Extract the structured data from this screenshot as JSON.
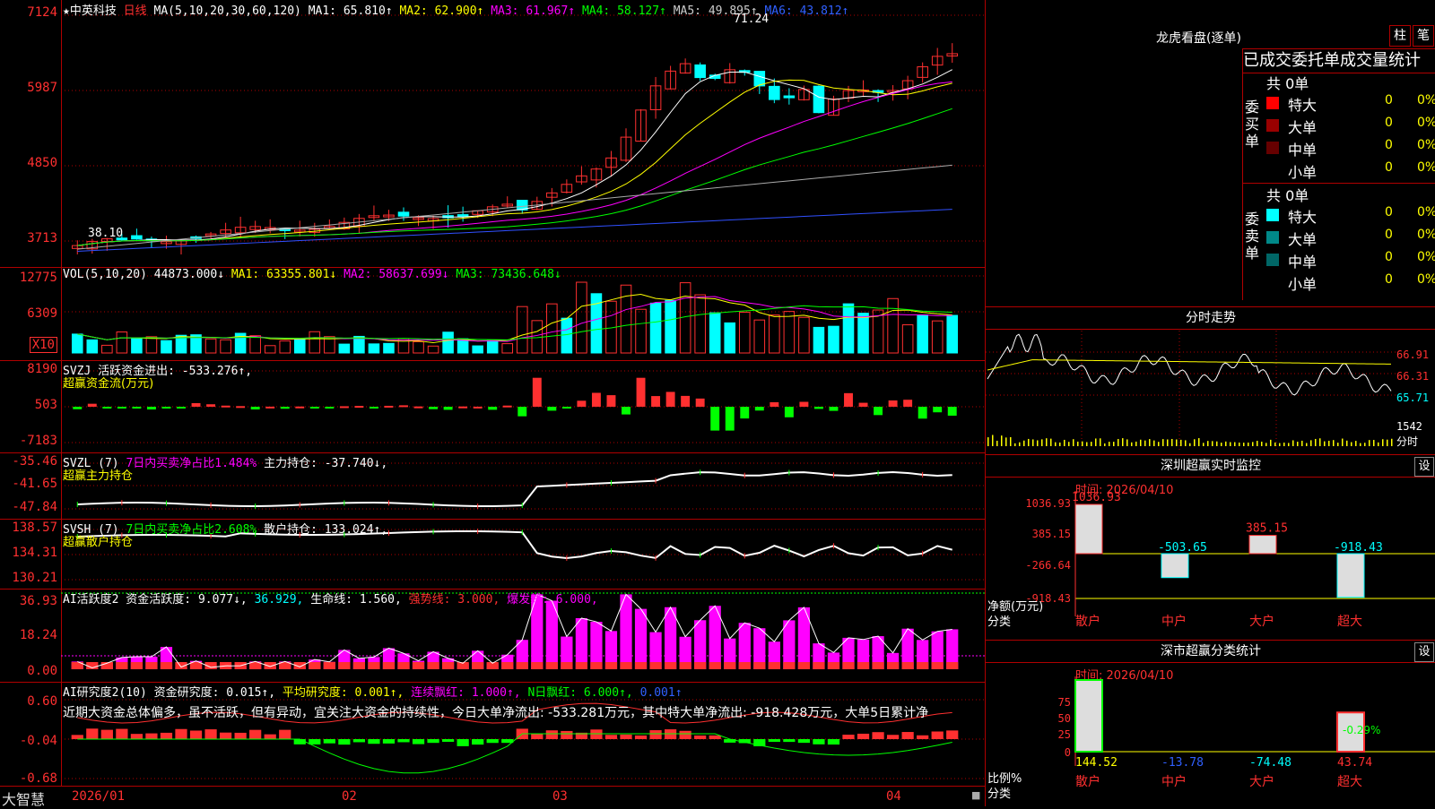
{
  "main": {
    "y_ticks": [
      "7124",
      "5987",
      "4850",
      "3713"
    ],
    "title_name": "★中英科技",
    "title_period": "日线",
    "title_ma": "MA(5,10,20,30,60,120)",
    "ma_labels": [
      "MA1: 65.810↑",
      "MA2: 62.900↑",
      "MA3: 61.967↑",
      "MA4: 58.127↑",
      "MA5: 49.895↑",
      "MA6: 43.812↑"
    ],
    "high_marker": "71.24",
    "low_marker": "38.10"
  },
  "vol": {
    "y_ticks": [
      "12775",
      "6309"
    ],
    "unit": "X10",
    "title": "VOL(5,10,20)",
    "value": "44873.000↓",
    "ma_labels": [
      "MA1: 63355.801↓",
      "MA2: 58637.699↓",
      "MA3: 73436.648↓"
    ]
  },
  "svzj": {
    "y_ticks": [
      "8190",
      "503",
      "-7183"
    ],
    "title": "SVZJ  活跃资金进出: -533.276↑,",
    "subtitle": "超赢资金流(万元)"
  },
  "svzl": {
    "y_ticks": [
      "-35.46",
      "-41.65",
      "-47.84"
    ],
    "title_a": "SVZL (7)",
    "title_b": "7日内买卖净占比1.484%",
    "title_c": "主力持仓: -37.740↓,",
    "subtitle": "超赢主力持仓"
  },
  "svsh": {
    "y_ticks": [
      "138.57",
      "134.31",
      "130.21"
    ],
    "title_a": "SVSH (7)",
    "title_b": "7日内买卖净占比2.608%",
    "title_c": "散户持仓: 133.024↑,",
    "subtitle": "超赢散户持仓"
  },
  "ai_active": {
    "y_ticks": [
      "36.93",
      "18.24",
      "0.00"
    ],
    "title_a": "AI活跃度2 资金活跃度: 9.077↓,",
    "title_b": "36.929,",
    "title_c": "生命线: 1.560,",
    "title_d": "强势线: 3.000,",
    "title_e": "爆发线: 6.000,"
  },
  "ai_research": {
    "y_ticks": [
      "0.60",
      "-0.04",
      "-0.68"
    ],
    "title_a": "AI研究度2(10) 资金研究度: 0.015↑,",
    "title_b": "平均研究度: 0.001↑,",
    "title_c": "连续飘红: 1.000↑,",
    "title_d": "N日飘红: 6.000↑,",
    "title_e": "0.001↑",
    "comment": "近期大资金总体偏多，虽不活跃，但有异动，宜关注大资金的持续性，今日大单净流出: -533.281万元，其中特大单净流出: -918.428万元，大单5日累计净"
  },
  "x_axis": {
    "brand": "大智慧",
    "labels": [
      "2026/01",
      "02",
      "03",
      "04"
    ]
  },
  "dragon": {
    "title": "龙虎看盘(逐单)",
    "btn_bar": "柱",
    "btn_pen": "笔",
    "header": "已成交委托单成交量统计",
    "buy_label": "委买单",
    "sell_label": "委卖单",
    "buy_total": "共 0单",
    "sell_total": "共 0单",
    "buy_rows": [
      {
        "name": "特大",
        "vol": "0",
        "pct": "0%"
      },
      {
        "name": "大单",
        "vol": "0",
        "pct": "0%"
      },
      {
        "name": "中单",
        "vol": "0",
        "pct": "0%"
      },
      {
        "name": "小单",
        "vol": "0",
        "pct": "0%"
      }
    ],
    "sell_rows": [
      {
        "name": "特大",
        "vol": "0",
        "pct": "0%"
      },
      {
        "name": "大单",
        "vol": "0",
        "pct": "0%"
      },
      {
        "name": "中单",
        "vol": "0",
        "pct": "0%"
      },
      {
        "name": "小单",
        "vol": "0",
        "pct": "0%"
      }
    ]
  },
  "intraday": {
    "title": "分时走势",
    "y_ticks": [
      "66.91",
      "66.31",
      "65.71"
    ],
    "vol_tick": "1542",
    "vol_unit": "分时"
  },
  "sz_monitor": {
    "title": "深圳超赢实时监控",
    "btn": "设",
    "time": "时间: 2026/04/10",
    "y_ticks": [
      "1036.93",
      "385.15",
      "-266.64",
      "-918.43"
    ],
    "unit_a": "净额(万元)",
    "unit_b": "分类",
    "bars": [
      {
        "cat": "散户",
        "value": "1036.93"
      },
      {
        "cat": "中户",
        "value": "-503.65"
      },
      {
        "cat": "大户",
        "value": "385.15"
      },
      {
        "cat": "超大",
        "value": "-918.43"
      }
    ]
  },
  "sz_class": {
    "title": "深市超赢分类统计",
    "btn": "设",
    "time": "时间: 2026/04/10",
    "y_ticks": [
      "75",
      "50",
      "25",
      "0"
    ],
    "unit_a": "比例%",
    "unit_b": "分类",
    "pct_label": "-0.29%",
    "bars": [
      {
        "cat": "散户",
        "value": "144.52"
      },
      {
        "cat": "中户",
        "value": "-13.78"
      },
      {
        "cat": "大户",
        "value": "-74.48"
      },
      {
        "cat": "超大",
        "value": "43.74"
      }
    ]
  },
  "colors": {
    "up": "#ff3030",
    "down": "#00ffff",
    "border": "#b00000",
    "yellow": "#ffff00",
    "magenta": "#ff00ff",
    "green": "#00ff00"
  }
}
